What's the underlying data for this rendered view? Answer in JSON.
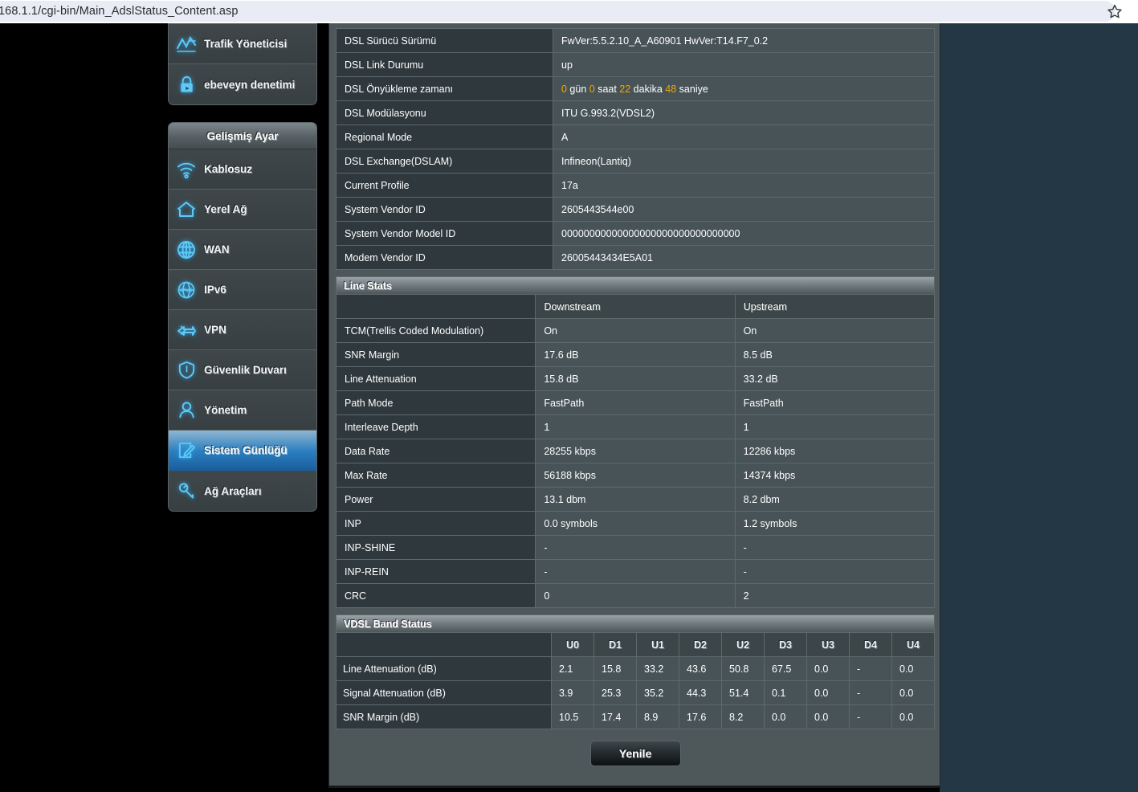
{
  "browser": {
    "url": "168.1.1/cgi-bin/Main_AdslStatus_Content.asp",
    "bookmark_icon": "star-icon"
  },
  "sidebar": {
    "top_items": [
      {
        "label": "Trafik Yöneticisi",
        "icon": "traffic-chart-icon"
      },
      {
        "label": "ebeveyn denetimi",
        "icon": "lock-icon"
      }
    ],
    "advanced_header": "Gelişmiş Ayar",
    "advanced_items": [
      {
        "label": "Kablosuz",
        "icon": "wifi-icon",
        "selected": false
      },
      {
        "label": "Yerel Ağ",
        "icon": "home-icon",
        "selected": false
      },
      {
        "label": "WAN",
        "icon": "globe-icon",
        "selected": false
      },
      {
        "label": "IPv6",
        "icon": "ipv6-icon",
        "selected": false
      },
      {
        "label": "VPN",
        "icon": "vpn-key-icon",
        "selected": false
      },
      {
        "label": "Güvenlik Duvarı",
        "icon": "shield-icon",
        "selected": false
      },
      {
        "label": "Yönetim",
        "icon": "user-icon",
        "selected": false
      },
      {
        "label": "Sistem Günlüğü",
        "icon": "log-edit-icon",
        "selected": true
      },
      {
        "label": "Ağ Araçları",
        "icon": "wrench-icon",
        "selected": false
      }
    ]
  },
  "colors": {
    "upstream": "#2fa8e0",
    "downstream": "#f07c1c",
    "highlight_number": "#f0a800",
    "panel_bg": "#4e585b",
    "accent_blue": "#2b7fc0"
  },
  "dsl_info": {
    "rows": [
      {
        "label": "DSL Sürücü Sürümü",
        "value": "FwVer:5.5.2.10_A_A60901 HwVer:T14.F7_0.2"
      },
      {
        "label": "DSL Link Durumu",
        "value": "up"
      },
      {
        "label": "DSL Önyükleme zamanı",
        "value": "0 gün 0 saat 22 dakika 48 saniye",
        "parts": [
          {
            "text": "0",
            "hl": true
          },
          {
            "text": " gün ",
            "hl": false
          },
          {
            "text": "0",
            "hl": true
          },
          {
            "text": " saat ",
            "hl": false
          },
          {
            "text": "22",
            "hl": true
          },
          {
            "text": " dakika ",
            "hl": false
          },
          {
            "text": "48",
            "hl": true
          },
          {
            "text": " saniye",
            "hl": false
          }
        ]
      },
      {
        "label": "DSL Modülasyonu",
        "value": "ITU G.993.2(VDSL2)"
      },
      {
        "label": "Regional Mode",
        "value": "A"
      },
      {
        "label": "DSL Exchange(DSLAM)",
        "value": "Infineon(Lantiq)"
      },
      {
        "label": "Current Profile",
        "value": "17a"
      },
      {
        "label": "System Vendor ID",
        "value": "2605443544e00"
      },
      {
        "label": "System Vendor Model ID",
        "value": "00000000000000000000000000000000"
      },
      {
        "label": "Modem Vendor ID",
        "value": "26005443434E5A01"
      }
    ]
  },
  "line_stats": {
    "section_title": "Line Stats",
    "columns": [
      "",
      "Downstream",
      "Upstream"
    ],
    "rows": [
      {
        "label": "TCM(Trellis Coded Modulation)",
        "down": "On",
        "up": "On"
      },
      {
        "label": "SNR Margin",
        "down": "17.6 dB",
        "up": "8.5 dB"
      },
      {
        "label": "Line Attenuation",
        "down": "15.8 dB",
        "up": "33.2 dB"
      },
      {
        "label": "Path Mode",
        "down": "FastPath",
        "up": "FastPath"
      },
      {
        "label": "Interleave Depth",
        "down": "1",
        "up": "1"
      },
      {
        "label": "Data Rate",
        "down": "28255 kbps",
        "up": "12286 kbps"
      },
      {
        "label": "Max Rate",
        "down": "56188 kbps",
        "up": "14374 kbps"
      },
      {
        "label": "Power",
        "down": "13.1 dbm",
        "up": "8.2 dbm"
      },
      {
        "label": "INP",
        "down": "0.0 symbols",
        "up": "1.2 symbols"
      },
      {
        "label": "INP-SHINE",
        "down": "-",
        "up": "-"
      },
      {
        "label": "INP-REIN",
        "down": "-",
        "up": "-"
      },
      {
        "label": "CRC",
        "down": "0",
        "up": "2"
      }
    ]
  },
  "vdsl_band_status": {
    "section_title": "VDSL Band Status",
    "bands": [
      "U0",
      "D1",
      "U1",
      "D2",
      "U2",
      "D3",
      "U3",
      "D4",
      "U4"
    ],
    "band_kinds": [
      "up",
      "down",
      "up",
      "down",
      "up",
      "down",
      "up",
      "down",
      "up"
    ],
    "rows": [
      {
        "label": "Line Attenuation (dB)",
        "values": [
          "2.1",
          "15.8",
          "33.2",
          "43.6",
          "50.8",
          "67.5",
          "0.0",
          "-",
          "0.0"
        ]
      },
      {
        "label": "Signal Attenuation (dB)",
        "values": [
          "3.9",
          "25.3",
          "35.2",
          "44.3",
          "51.4",
          "0.1",
          "0.0",
          "-",
          "0.0"
        ]
      },
      {
        "label": "SNR Margin (dB)",
        "values": [
          "10.5",
          "17.4",
          "8.9",
          "17.6",
          "8.2",
          "0.0",
          "0.0",
          "-",
          "0.0"
        ]
      }
    ]
  },
  "footer": {
    "refresh_label": "Yenile"
  }
}
